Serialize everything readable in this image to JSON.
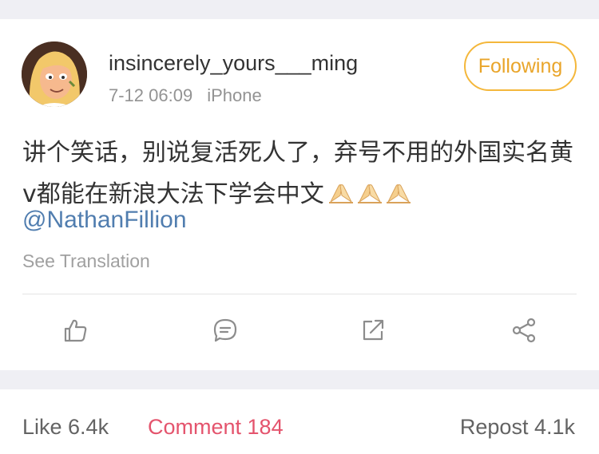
{
  "post": {
    "username": "insincerely_yours___ming",
    "time": "7-12 06:09",
    "source": "iPhone",
    "follow_label": "Following",
    "text": "讲个笑话，别说复活死人了，弃号不用的外国实名黄v都能在新浪大法下学会中文",
    "emoji": [
      "folded-hands",
      "folded-hands",
      "folded-hands"
    ],
    "mention": "@NathanFillion",
    "see_translation": "See Translation"
  },
  "actions": {
    "icons": [
      "like-icon",
      "comment-icon",
      "repost-icon",
      "share-icon"
    ]
  },
  "stats": {
    "like": "Like 6.4k",
    "comment": "Comment 184",
    "repost": "Repost 4.1k"
  },
  "colors": {
    "follow_accent": "#f4b73b",
    "mention": "#507daf",
    "active_tab": "#e4546d",
    "background": "#efeff4"
  }
}
